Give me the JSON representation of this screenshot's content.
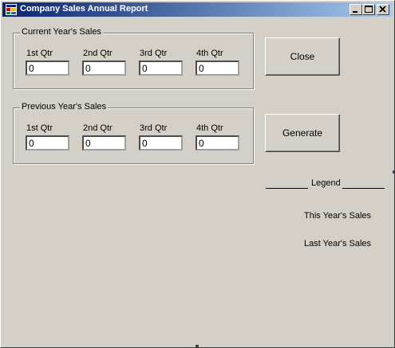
{
  "window": {
    "title": "Company Sales Annual Report",
    "controls": [
      "minimize",
      "maximize",
      "close"
    ]
  },
  "current_group": {
    "title": "Current Year's Sales",
    "quarters": [
      {
        "label": "1st Qtr",
        "value": "0"
      },
      {
        "label": "2nd Qtr",
        "value": "0"
      },
      {
        "label": "3rd Qtr",
        "value": "0"
      },
      {
        "label": "4th Qtr",
        "value": "0"
      }
    ]
  },
  "previous_group": {
    "title": "Previous Year's Sales",
    "quarters": [
      {
        "label": "1st Qtr",
        "value": "0"
      },
      {
        "label": "2nd Qtr",
        "value": "0"
      },
      {
        "label": "3rd Qtr",
        "value": "0"
      },
      {
        "label": "4th Qtr",
        "value": "0"
      }
    ]
  },
  "buttons": {
    "close_label": "Close",
    "generate_label": "Generate"
  },
  "legend": {
    "title": "Legend",
    "this_year": "This Year's Sales",
    "last_year": "Last Year's Sales"
  },
  "colors": {
    "face": "#d4d0c8",
    "title_start": "#0a246a",
    "title_end": "#a6caf0"
  }
}
